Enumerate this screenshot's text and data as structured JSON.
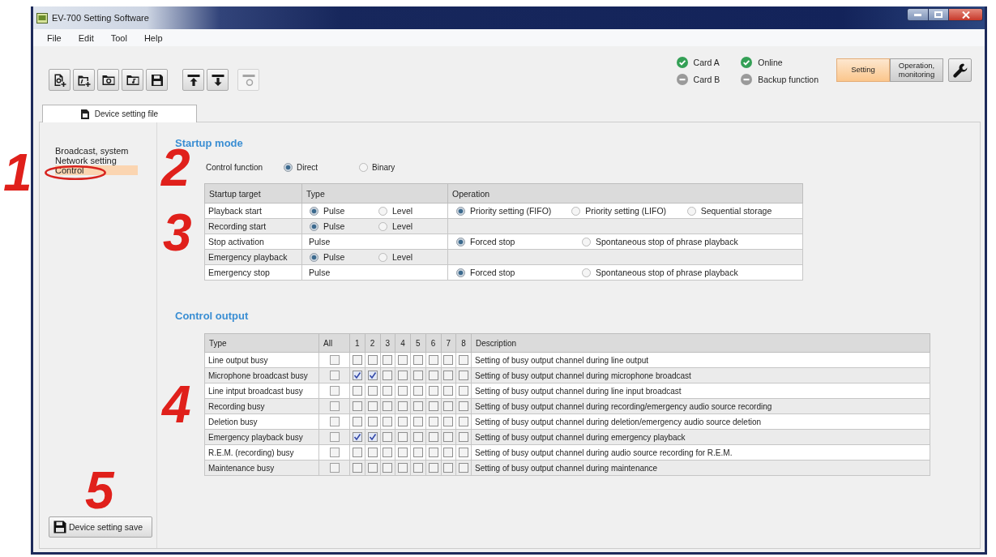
{
  "window": {
    "title": "EV-700 Setting Software"
  },
  "menu": [
    "File",
    "Edit",
    "Tool",
    "Help"
  ],
  "toolbar": [
    {
      "buttons": [
        {
          "disabled": false
        },
        {
          "disabled": false
        },
        {
          "disabled": false
        },
        {
          "disabled": false
        },
        {
          "disabled": false
        }
      ]
    },
    {
      "buttons": [
        {
          "disabled": false
        },
        {
          "disabled": false
        }
      ]
    },
    {
      "buttons": [
        {
          "disabled": true
        }
      ]
    }
  ],
  "status": [
    {
      "label": "Card A",
      "on": true
    },
    {
      "label": "Card B",
      "on": false
    },
    {
      "label": "Online",
      "on": true
    },
    {
      "label": "Backup function",
      "on": false
    }
  ],
  "mode_buttons": [
    {
      "label": "Setting",
      "selected": true
    },
    {
      "label": "Operation, monitoring",
      "selected": false
    }
  ],
  "tabs": [
    {
      "label": "Device setting file",
      "selected": true
    }
  ],
  "sidebar": {
    "items": [
      {
        "label": "Broadcast, system",
        "selected": false
      },
      {
        "label": "Network setting",
        "selected": false
      },
      {
        "label": "Control",
        "selected": true
      }
    ]
  },
  "startup_mode": {
    "title": "Startup mode",
    "control_function": {
      "label": "Control function",
      "options": [
        {
          "label": "Direct",
          "selected": true
        },
        {
          "label": "Binary",
          "selected": false
        }
      ]
    },
    "table": {
      "columns": [
        "Startup target",
        "Type",
        "Operation"
      ],
      "rows": [
        {
          "target": "Playback start",
          "type": {
            "kind": "radio",
            "options": [
              {
                "label": "Pulse",
                "selected": true
              },
              {
                "label": "Level",
                "selected": false
              }
            ]
          },
          "operation": [
            {
              "label": "Priority setting (FIFO)",
              "selected": true
            },
            {
              "label": "Priority setting (LIFO)",
              "selected": false
            },
            {
              "label": "Sequential storage",
              "selected": false
            }
          ]
        },
        {
          "target": "Recording start",
          "type": {
            "kind": "radio",
            "options": [
              {
                "label": "Pulse",
                "selected": true
              },
              {
                "label": "Level",
                "selected": false
              }
            ]
          }
        },
        {
          "target": "Stop activation",
          "type": {
            "kind": "text",
            "text": "Pulse"
          },
          "operation": [
            {
              "label": "Forced stop",
              "selected": true
            },
            {
              "label": "Spontaneous stop of phrase playback",
              "selected": false
            }
          ]
        },
        {
          "target": "Emergency playback",
          "type": {
            "kind": "radio",
            "options": [
              {
                "label": "Pulse",
                "selected": true
              },
              {
                "label": "Level",
                "selected": false
              }
            ]
          }
        },
        {
          "target": "Emergency stop",
          "type": {
            "kind": "text",
            "text": "Pulse"
          },
          "operation": [
            {
              "label": "Forced stop",
              "selected": true
            },
            {
              "label": "Spontaneous stop of phrase playback",
              "selected": false
            }
          ]
        }
      ]
    }
  },
  "control_output": {
    "title": "Control output",
    "table": {
      "columns": [
        "Type",
        "All",
        "1",
        "2",
        "3",
        "4",
        "5",
        "6",
        "7",
        "8",
        "Description"
      ],
      "rows": [
        {
          "type": "Line output busy",
          "all": {
            "checked": false
          },
          "channels": [
            {
              "checked": false
            },
            {
              "checked": false
            },
            {
              "checked": false
            },
            {
              "checked": false
            },
            {
              "checked": false
            },
            {
              "checked": false
            },
            {
              "checked": false
            },
            {
              "checked": false
            }
          ],
          "description": "Setting of busy output channel during line output"
        },
        {
          "type": "Microphone broadcast busy",
          "all": {
            "checked": false
          },
          "channels": [
            {
              "checked": true
            },
            {
              "checked": true
            },
            {
              "checked": false
            },
            {
              "checked": false
            },
            {
              "checked": false
            },
            {
              "checked": false
            },
            {
              "checked": false
            },
            {
              "checked": false
            }
          ],
          "description": "Setting of busy output channel during microphone broadcast"
        },
        {
          "type": "Line intput broadcast busy",
          "all": {
            "checked": false
          },
          "channels": [
            {
              "checked": false
            },
            {
              "checked": false
            },
            {
              "checked": false
            },
            {
              "checked": false
            },
            {
              "checked": false
            },
            {
              "checked": false
            },
            {
              "checked": false
            },
            {
              "checked": false
            }
          ],
          "description": "Setting of busy output channel during line input broadcast"
        },
        {
          "type": "Recording busy",
          "all": {
            "checked": false
          },
          "channels": [
            {
              "checked": false
            },
            {
              "checked": false
            },
            {
              "checked": false
            },
            {
              "checked": false
            },
            {
              "checked": false
            },
            {
              "checked": false
            },
            {
              "checked": false
            },
            {
              "checked": false
            }
          ],
          "description": "Setting of busy output channel during recording/emergency audio source recording"
        },
        {
          "type": "Deletion busy",
          "all": {
            "checked": false
          },
          "channels": [
            {
              "checked": false
            },
            {
              "checked": false
            },
            {
              "checked": false
            },
            {
              "checked": false
            },
            {
              "checked": false
            },
            {
              "checked": false
            },
            {
              "checked": false
            },
            {
              "checked": false
            }
          ],
          "description": "Setting of busy output channel during deletion/emergency audio source deletion"
        },
        {
          "type": "Emergency playback busy",
          "all": {
            "checked": false
          },
          "channels": [
            {
              "checked": true
            },
            {
              "checked": true
            },
            {
              "checked": false
            },
            {
              "checked": false
            },
            {
              "checked": false
            },
            {
              "checked": false
            },
            {
              "checked": false
            },
            {
              "checked": false
            }
          ],
          "description": "Setting of busy output channel during emergency playback"
        },
        {
          "type": "R.E.M. (recording) busy",
          "all": {
            "checked": false
          },
          "channels": [
            {
              "checked": false
            },
            {
              "checked": false
            },
            {
              "checked": false
            },
            {
              "checked": false
            },
            {
              "checked": false
            },
            {
              "checked": false
            },
            {
              "checked": false
            },
            {
              "checked": false
            }
          ],
          "description": "Setting of busy output channel during audio source recording for R.E.M."
        },
        {
          "type": "Maintenance busy",
          "all": {
            "checked": false
          },
          "channels": [
            {
              "checked": false
            },
            {
              "checked": false
            },
            {
              "checked": false
            },
            {
              "checked": false
            },
            {
              "checked": false
            },
            {
              "checked": false
            },
            {
              "checked": false
            },
            {
              "checked": false
            }
          ],
          "description": "Setting of busy output channel during maintenance"
        }
      ]
    }
  },
  "save_button": {
    "label": "Device setting save"
  },
  "callouts": [
    {
      "label": "1"
    },
    {
      "label": "2"
    },
    {
      "label": "3"
    },
    {
      "label": "4"
    },
    {
      "label": "5"
    }
  ]
}
